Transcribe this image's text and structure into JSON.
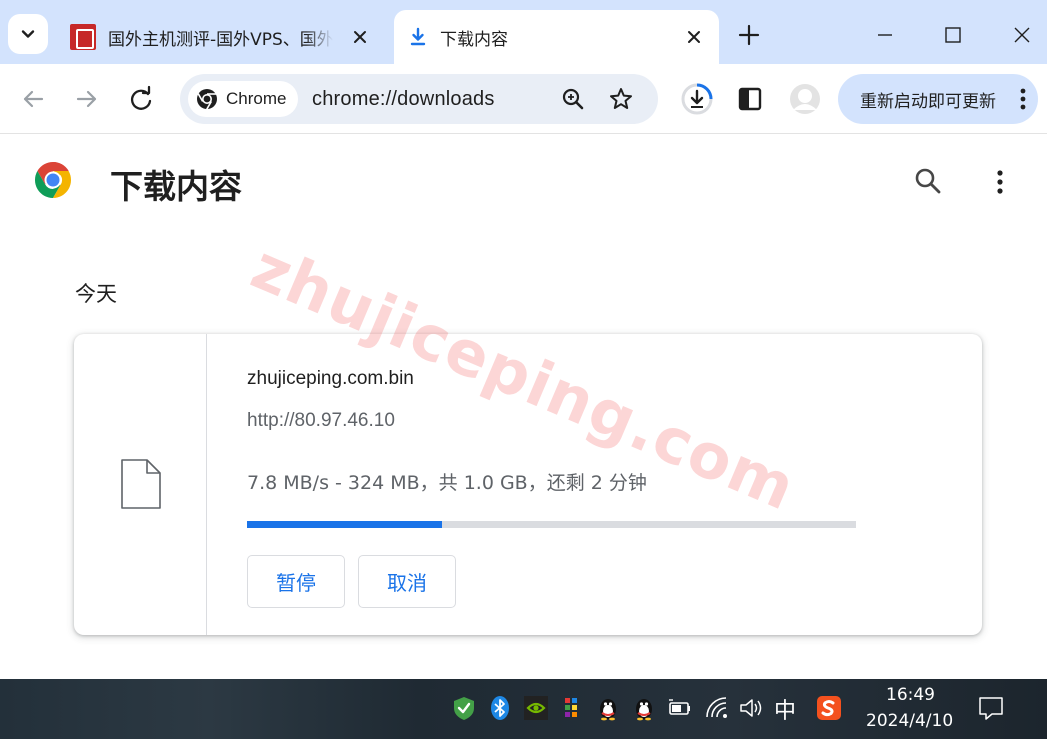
{
  "tabs": [
    {
      "title": "国外主机测评-国外VPS、国外",
      "active": false
    },
    {
      "title": "下载内容",
      "active": true
    }
  ],
  "toolbar": {
    "site_chip_label": "Chrome",
    "url": "chrome://downloads",
    "update_button_label": "重新启动即可更新"
  },
  "page": {
    "title": "下载内容",
    "date_section": "今天",
    "download": {
      "file_name": "zhujiceping.com.bin",
      "source_url": "http://80.97.46.10",
      "status": "7.8 MB/s - 324 MB，共 1.0 GB，还剩 2 分钟",
      "progress_fraction": 0.32,
      "pause_label": "暂停",
      "cancel_label": "取消"
    },
    "watermark": "zhujiceping.com"
  },
  "taskbar": {
    "ime_label": "中",
    "time": "16:49",
    "date": "2024/4/10"
  },
  "colors": {
    "accent": "#1a73e8",
    "tabstrip": "#d3e3fd",
    "omnibox": "#e9eef6"
  }
}
